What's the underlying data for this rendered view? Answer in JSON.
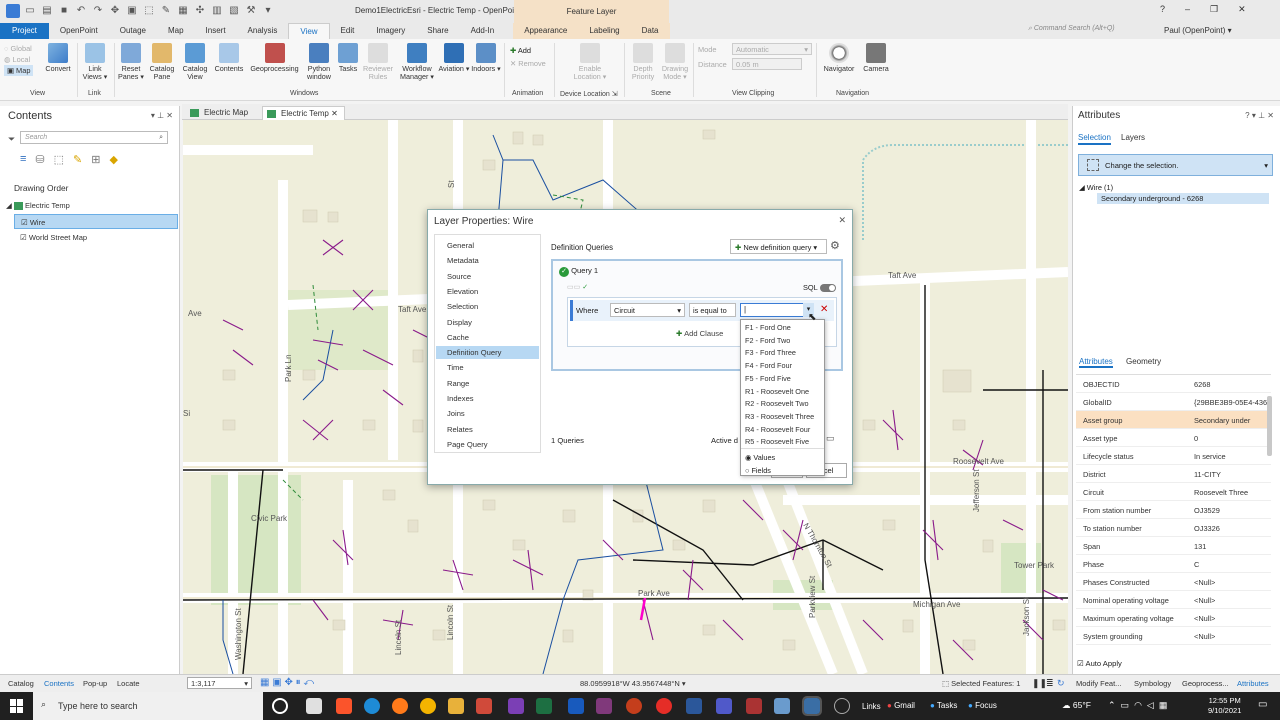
{
  "window": {
    "title": "Demo1ElectricEsri - Electric Temp - OpenPoint",
    "context_tab": "Feature Layer",
    "help": "?",
    "minimize": "–",
    "maximize": "❐",
    "close": "✕"
  },
  "tabs": [
    "Project",
    "OpenPoint",
    "Outage",
    "Map",
    "Insert",
    "Analysis",
    "View",
    "Edit",
    "Imagery",
    "Share",
    "Add-In",
    "Appearance",
    "Labeling",
    "Data"
  ],
  "active_tab": "View",
  "command_search": {
    "placeholder": "Command Search (Alt+Q)"
  },
  "user": "Paul (OpenPoint) ▾",
  "ribbon": {
    "view_group": {
      "global": "Global",
      "local": "Local",
      "map": "Map",
      "label": "View"
    },
    "convert": "Convert",
    "link": {
      "link_views": "Link Views ▾",
      "label": "Link"
    },
    "windows": {
      "reset_panes": "Reset Panes ▾",
      "catalog_pane": "Catalog Pane",
      "catalog_view": "Catalog View",
      "contents": "Contents",
      "geoprocessing": "Geoprocessing",
      "python_window": "Python window",
      "tasks": "Tasks",
      "reviewer_rules": "Reviewer Rules",
      "workflow_manager": "Workflow Manager ▾",
      "aviation": "Aviation ▾",
      "indoors": "Indoors ▾",
      "label": "Windows"
    },
    "animation": {
      "add": "Add",
      "remove": "Remove",
      "label": "Animation"
    },
    "device_location": {
      "enable": "Enable Location ▾",
      "label": "Device Location"
    },
    "scene": {
      "depth_priority": "Depth Priority",
      "drawing_mode": "Drawing Mode ▾",
      "label": "Scene"
    },
    "view_clipping": {
      "mode_label": "Mode",
      "mode_value": "Automatic",
      "distance_label": "Distance",
      "distance_value": "0.05 m",
      "label": "View Clipping"
    },
    "navigation": {
      "navigator": "Navigator",
      "camera": "Camera",
      "label": "Navigation"
    }
  },
  "contents_pane": {
    "title": "Contents",
    "search_placeholder": "Search",
    "drawing_order": "Drawing Order",
    "layers": [
      {
        "name": "Electric Temp",
        "kind": "map"
      },
      {
        "name": "Wire",
        "kind": "layer",
        "selected": true
      },
      {
        "name": "World Street Map",
        "kind": "layer"
      }
    ]
  },
  "map_tabs": [
    {
      "label": "Electric Map"
    },
    {
      "label": "Electric Temp",
      "active": true
    }
  ],
  "map_labels": {
    "taft_ave_1": "Taft Ave",
    "taft_ave_2": "Taft Ave",
    "roosevelt_ave": "Roosevelt Ave",
    "park_ave": "Park Ave",
    "michigan_ave": "Michigan Ave",
    "civic_park": "Civic Park",
    "tower_park": "Tower Park",
    "washington_st": "Washington St",
    "jefferson_st": "Jefferson St",
    "jackson_st": "Jackson St",
    "lincoln_st": "Lincoln St",
    "park_ln": "Park Ln",
    "n_thornton_st": "N Thornton St",
    "parkview_st": "Parkview St",
    "lincoln_st_2": "Lincoln St",
    "e_lincoln_st": "Lincoln St",
    "ave_1": "Ave",
    "st_1": "St",
    "st_2": "St",
    "si": "Si"
  },
  "dialog": {
    "title": "Layer Properties: Wire",
    "nav": [
      "General",
      "Metadata",
      "Source",
      "Elevation",
      "Selection",
      "Display",
      "Cache",
      "Definition Query",
      "Time",
      "Range",
      "Indexes",
      "Joins",
      "Relates",
      "Page Query"
    ],
    "selected_nav": "Definition Query",
    "heading": "Definition Queries",
    "new_query": "New definition query",
    "query_name": "Query 1",
    "sql_label": "SQL",
    "where": "Where",
    "field": "Circuit",
    "operator": "is equal to",
    "value": "|",
    "add_clause": "Add Clause",
    "queries_count": "1 Queries",
    "active_label": "Active d",
    "ok": "OK",
    "cancel": "ncel",
    "dropdown_options": [
      "F1 - Ford One",
      "F2 - Ford Two",
      "F3 - Ford Three",
      "F4 - Ford Four",
      "F5 - Ford Five",
      "R1 - Roosevelt One",
      "R2 - Roosevelt Two",
      "R3 - Roosevelt Three",
      "R4 - Roosevelt Four",
      "R5 - Roosevelt Five"
    ],
    "radio_values": "Values",
    "radio_fields": "Fields"
  },
  "attributes_pane": {
    "title": "Attributes",
    "tab_selection": "Selection",
    "tab_layers": "Layers",
    "change_selection": "Change the selection.",
    "tree_layer": "Wire (1)",
    "tree_feature": "Secondary underground - 6268",
    "tab_attributes": "Attributes",
    "tab_geometry": "Geometry",
    "rows": [
      {
        "k": "OBJECTID",
        "v": "6268"
      },
      {
        "k": "GlobalID",
        "v": "{29BBE3B9-05E4-4368"
      },
      {
        "k": "Asset group",
        "v": "Secondary under"
      },
      {
        "k": "Asset type",
        "v": "0"
      },
      {
        "k": "Lifecycle status",
        "v": "In service"
      },
      {
        "k": "District",
        "v": "11-CITY"
      },
      {
        "k": "Circuit",
        "v": "Roosevelt Three"
      },
      {
        "k": "From station number",
        "v": "OJ3529"
      },
      {
        "k": "To station number",
        "v": "OJ3326"
      },
      {
        "k": "Span",
        "v": "131"
      },
      {
        "k": "Phase",
        "v": "C"
      },
      {
        "k": "Phases Constructed",
        "v": "<Null>"
      },
      {
        "k": "Nominal operating voltage",
        "v": "<Null>"
      },
      {
        "k": "Maximum operating voltage",
        "v": "<Null>"
      },
      {
        "k": "System grounding",
        "v": "<Null>"
      }
    ],
    "auto_apply": "Auto Apply"
  },
  "status_bar": {
    "catalog": "Catalog",
    "contents": "Contents",
    "popup": "Pop-up",
    "locate": "Locate",
    "scale": "1:3,117",
    "coordinates": "88.0959918°W 43.9567448°N",
    "selected_features": "Selected Features: 1",
    "modify": "Modify Feat...",
    "symbology": "Symbology",
    "geoprocess": "Geoprocess...",
    "attributes": "Attributes"
  },
  "taskbar": {
    "search_placeholder": "Type here to search",
    "links": "Links",
    "gmail": "Gmail",
    "tasks": "Tasks",
    "focus": "Focus",
    "weather": "65°F",
    "time": "12:55 PM",
    "date": "9/10/2021"
  },
  "colors": {
    "accent": "#1a72c4",
    "selected_row": "#b7d8f3",
    "wire_purple": "#8a1a8a",
    "wire_blue": "#1a4fa0",
    "wire_green": "#2e8b3a",
    "map_bg": "#efeedb",
    "asset_highlight": "#fbe0c2"
  }
}
